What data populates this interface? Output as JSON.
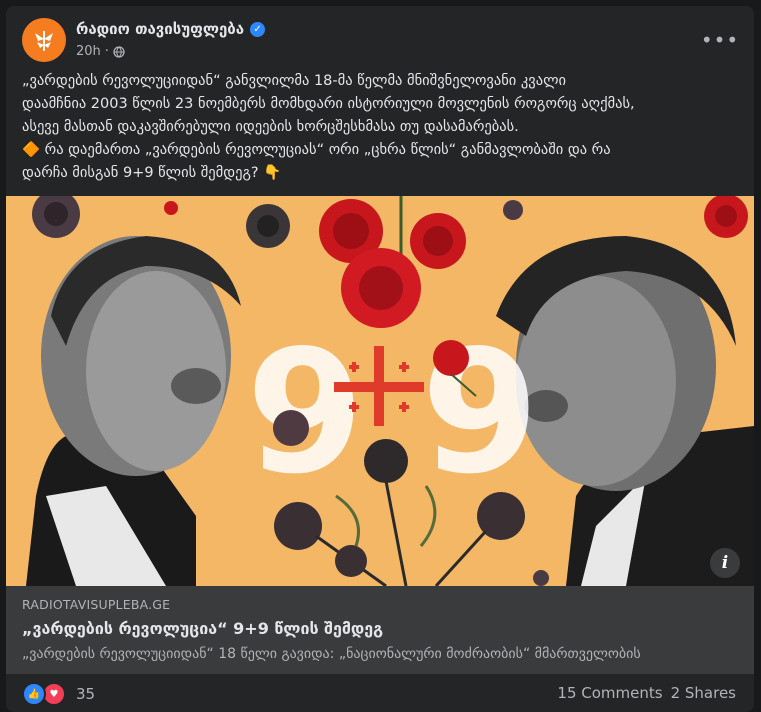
{
  "page": {
    "name": "რადიო თავისუფლება",
    "time": "20h",
    "audience_icon": "globe-icon",
    "more_icon": "more-options-icon"
  },
  "post": {
    "line1": "„ვარდების რევოლუციიდან“ განვლილმა 18-მა წელმა მნიშვნელოვანი კვალი",
    "line2": "დაამჩნია 2003 წლის 23 ნოემბერს მომხდარი ისტორიული მოვლენის როგორც აღქმას,",
    "line3": "ასევე მასთან დაკავშირებული იდეების ხორცშესხმასა თუ დასამარებას.",
    "line4_prefix": "🔶",
    "line4": "რა დაემართა „ვარდების რევოლუციას“ ორი „ცხრა წლის“ განმავლობაში და რა",
    "line5": "დარჩა მისგან 9+9 წლის შემდეგ?",
    "line5_suffix": "👇"
  },
  "media": {
    "graphic_numbers": [
      "9",
      "9"
    ],
    "info_icon_label": "i"
  },
  "link": {
    "domain": "RADIOTAVISUPLEBA.GE",
    "title": "„ვარდების რევოლუცია“ 9+9 წლის შემდეგ",
    "description": "„ვარდების რევოლუციიდან“ 18 წელი გავიდა: „ნაციონალური მოძრაობის“ მმართველობის"
  },
  "footer": {
    "reaction_count": "35",
    "comments": "15 Comments",
    "shares": "2 Shares"
  },
  "colors": {
    "card_bg": "#242526",
    "brand_orange": "#f57d20",
    "poster_bg": "#f3b766",
    "rose_red": "#c8161d",
    "verified_blue": "#2d88ff"
  }
}
